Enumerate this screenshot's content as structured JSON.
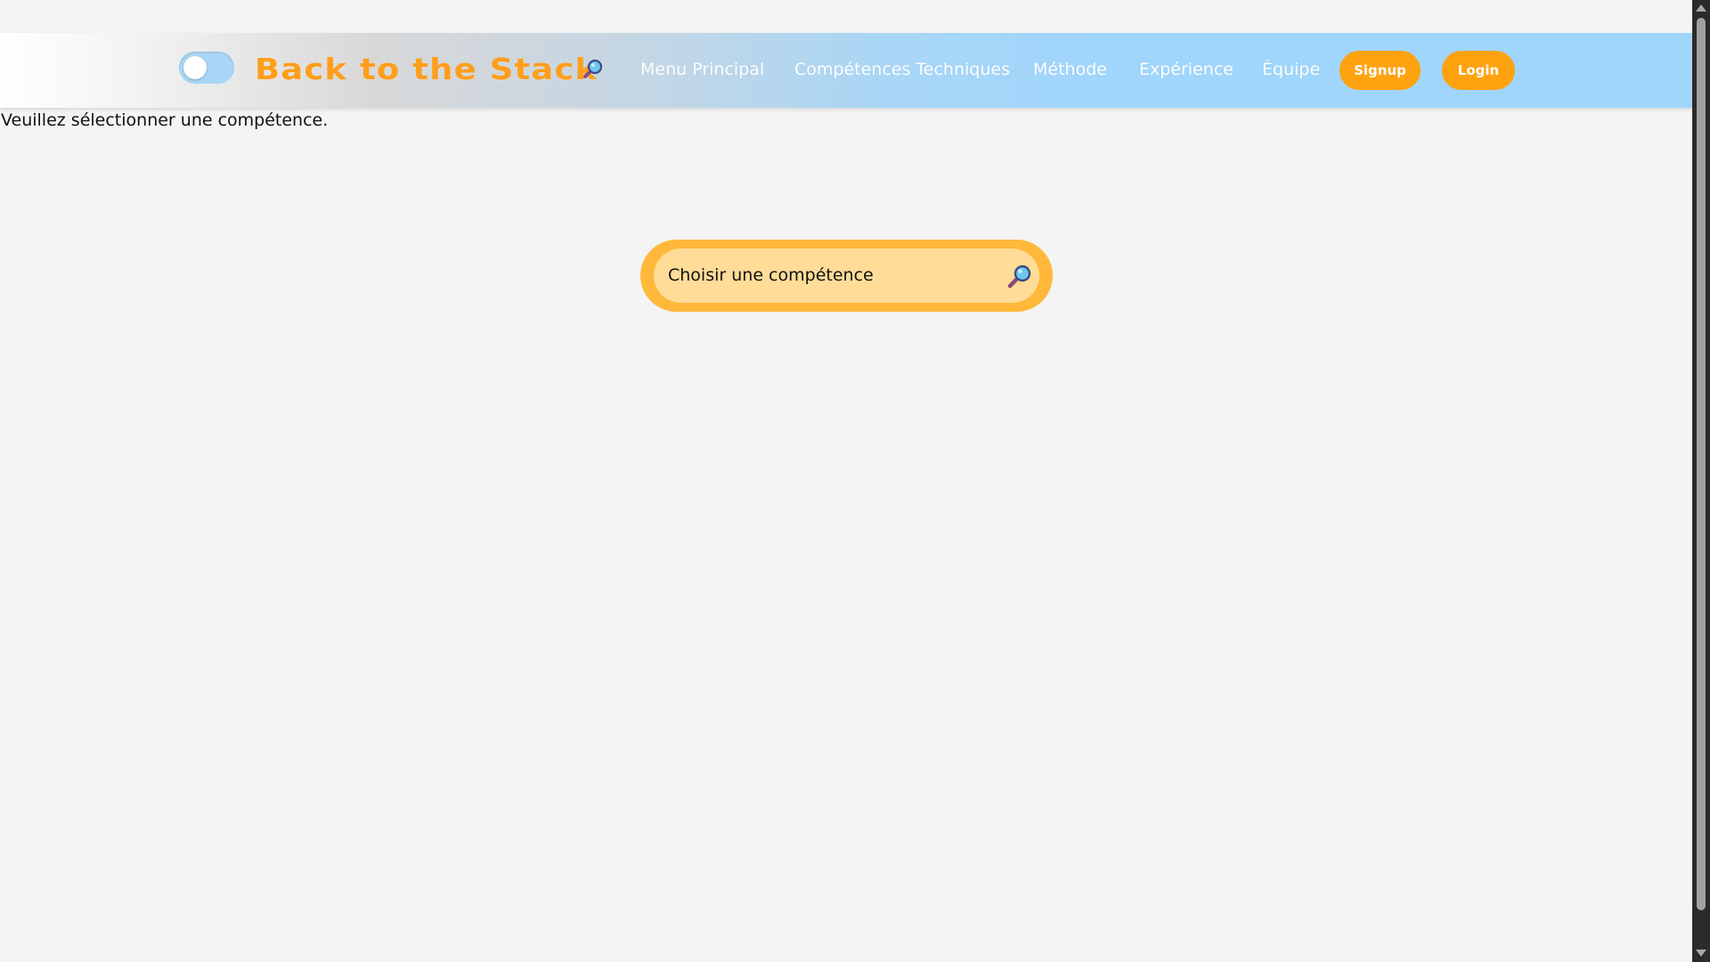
{
  "header": {
    "brand": "Back to the Stack",
    "theme_toggle_on": false,
    "nav": [
      {
        "label": "Menu Principal"
      },
      {
        "label": "Compétences Techniques"
      },
      {
        "label": "Méthode"
      },
      {
        "label": "Expérience"
      },
      {
        "label": "Équipe"
      }
    ],
    "signup_label": "Signup",
    "login_label": "Login",
    "search_icon": "magnifier-icon"
  },
  "main": {
    "message": "Veuillez sélectionner une compétence.",
    "skill_search": {
      "label": "Choisir une compétence",
      "icon": "magnifier-icon"
    }
  },
  "colors": {
    "accent_orange": "#ffa20f",
    "brand_text": "#ff9e1b",
    "header_blue": "#a0d5fc",
    "pill_outer": "#ffb83a",
    "pill_inner": "#ffdc97",
    "page_background": "#f4f4f4"
  }
}
